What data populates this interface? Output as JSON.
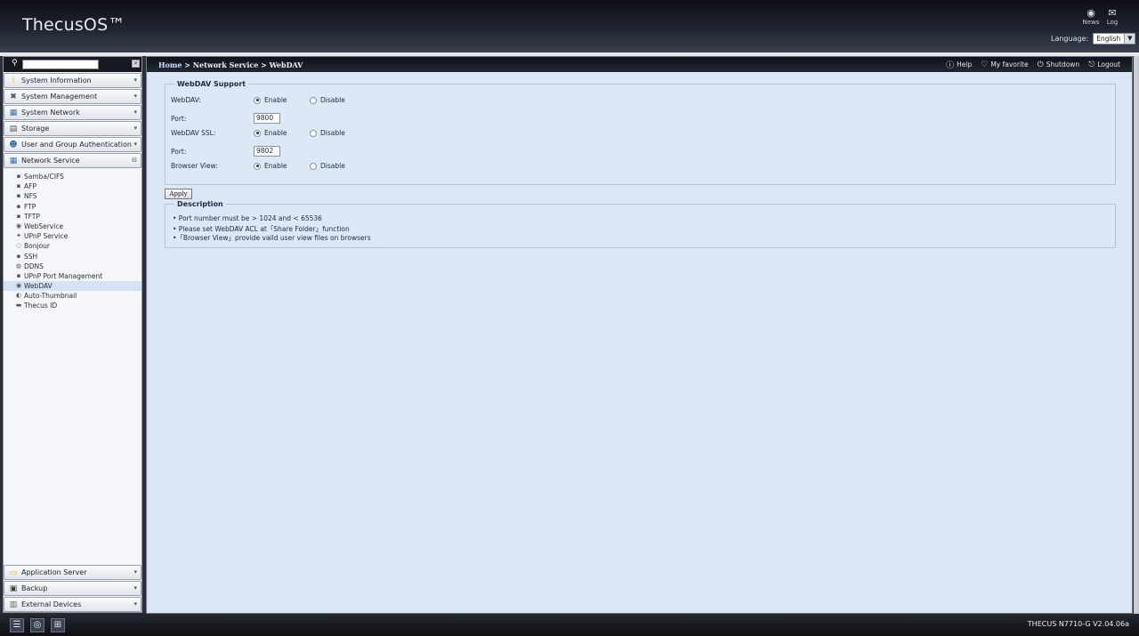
{
  "header": {
    "logo": "ThecusOS™",
    "icons": [
      {
        "name": "news",
        "label": "News",
        "glyph": "◉"
      },
      {
        "name": "log",
        "label": "Log",
        "glyph": "✉"
      }
    ],
    "language_label": "Language:",
    "language_value": "English"
  },
  "sidebar": {
    "search_placeholder": "",
    "categories_top": [
      {
        "label": "System Information",
        "icon": "info-icon",
        "glyph": "i",
        "color": "#e8b820"
      },
      {
        "label": "System Management",
        "icon": "tools-icon",
        "glyph": "✖",
        "color": "#555"
      },
      {
        "label": "System Network",
        "icon": "network-icon",
        "glyph": "▦",
        "color": "#3a6ea5"
      },
      {
        "label": "Storage",
        "icon": "storage-icon",
        "glyph": "▤",
        "color": "#555"
      },
      {
        "label": "User and Group Authentication",
        "icon": "users-icon",
        "glyph": "☻",
        "color": "#3a6ea5"
      },
      {
        "label": "Network Service",
        "icon": "network-service-icon",
        "glyph": "▦",
        "color": "#3a6ea5"
      }
    ],
    "network_service_items": [
      "Samba/CIFS",
      "AFP",
      "NFS",
      "FTP",
      "TFTP",
      "WebService",
      "UPnP Service",
      "Bonjour",
      "SSH",
      "DDNS",
      "UPnP Port Management",
      "WebDAV",
      "Auto-Thumbnail",
      "Thecus ID"
    ],
    "active_item": "WebDAV",
    "categories_bottom": [
      {
        "label": "Application Server",
        "icon": "app-server-icon",
        "glyph": "▭",
        "color": "#e8b820"
      },
      {
        "label": "Backup",
        "icon": "backup-icon",
        "glyph": "▣",
        "color": "#444"
      },
      {
        "label": "External Devices",
        "icon": "external-devices-icon",
        "glyph": "▥",
        "color": "#666"
      }
    ]
  },
  "topbar": {
    "breadcrumb_home": "Home",
    "breadcrumb_rest": " > Network Service > WebDAV",
    "help": "Help",
    "favorite": "My favorite",
    "shutdown": "Shutdown",
    "logout": "Logout"
  },
  "webdav": {
    "legend": "WebDAV Support",
    "webdav_label": "WebDAV:",
    "enable": "Enable",
    "disable": "Disable",
    "port_label": "Port:",
    "port_value": "9800",
    "ssl_label": "WebDAV SSL:",
    "ssl_port_value": "9802",
    "browser_label": "Browser View:",
    "apply": "Apply"
  },
  "description": {
    "legend": "Description",
    "lines": [
      "• Port number must be > 1024 and < 65536",
      "• Please set WebDAV ACL at「Share Folder」function",
      "•「Browser View」provide vaild user view files on browsers"
    ]
  },
  "footer": {
    "version": "THECUS N7710-G V2.04.06a"
  }
}
